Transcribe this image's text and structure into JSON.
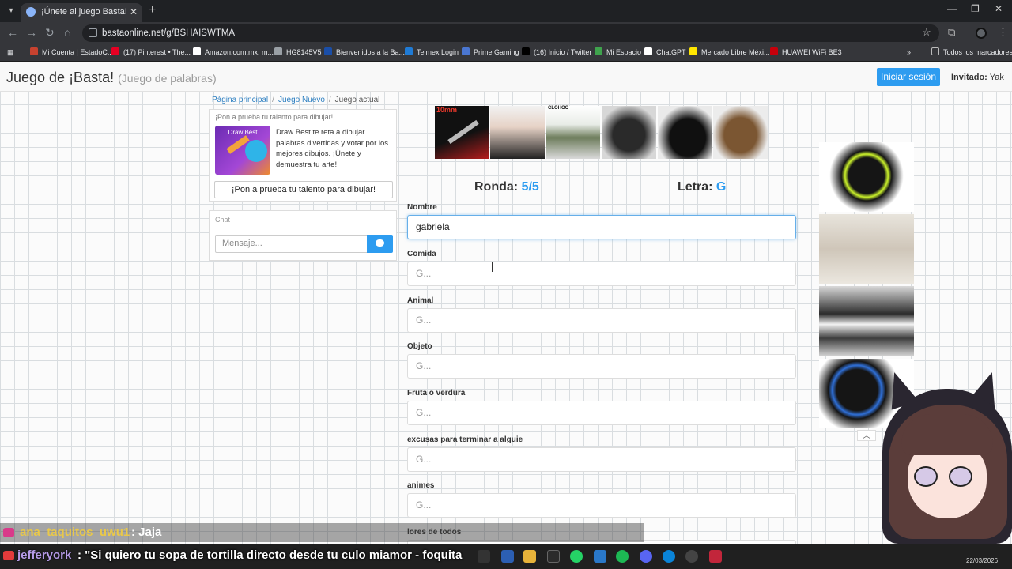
{
  "browser": {
    "tab_title": "¡Únete al juego Basta!",
    "tab_close": "✕",
    "new_tab": "+",
    "url": "bastaonline.net/g/BSHAISWTMA",
    "window_controls": [
      "—",
      "❐",
      "✕"
    ],
    "bookmarks": [
      {
        "label": "Mi Cuenta | EstadoC...",
        "color": "#c7422f"
      },
      {
        "label": "(17) Pinterest • The...",
        "color": "#e60023"
      },
      {
        "label": "Amazon.com.mx: m...",
        "color": "#ffffff"
      },
      {
        "label": "HG8145V5",
        "color": "#9aa0a6"
      },
      {
        "label": "Bienvenidos a la Ba...",
        "color": "#1a4ea8"
      },
      {
        "label": "Telmex Login",
        "color": "#1f7bd6"
      },
      {
        "label": "Prime Gaming",
        "color": "#4a76d1"
      },
      {
        "label": "(16) Inicio / Twitter",
        "color": "#000000"
      },
      {
        "label": "Mi Espacio",
        "color": "#3fa34d"
      },
      {
        "label": "ChatGPT",
        "color": "#ffffff"
      },
      {
        "label": "Mercado Libre Méxi...",
        "color": "#ffe600"
      },
      {
        "label": "HUAWEI WiFi BE3",
        "color": "#c7000b"
      }
    ],
    "bookmarks_more": "»",
    "all_bookmarks": "Todos los marcadores"
  },
  "header": {
    "title": "Juego de ¡Basta!",
    "subtitle": "(Juego de palabras)",
    "login_label": "Iniciar sesión",
    "guest_prefix": "Invitado:",
    "guest_name": "Yak"
  },
  "breadcrumb": {
    "home": "Página principal",
    "new_game": "Juego Nuevo",
    "current": "Juego actual",
    "sep": "/"
  },
  "promo": {
    "title": "¡Pon a prueba tu talento para dibujar!",
    "image_label": "Draw Best",
    "text": "Draw Best te reta a dibujar palabras divertidas y votar por los mejores dibujos. ¡Únete y demuestra tu arte!",
    "button_label": "¡Pon a prueba tu talento para dibujar!"
  },
  "chat": {
    "title": "Chat",
    "placeholder": "Mensaje..."
  },
  "ads": {
    "first_caption": "10mm",
    "third_caption": "CLOHOO"
  },
  "game": {
    "round_label": "Ronda:",
    "round_value": "5/5",
    "letter_label": "Letra:",
    "letter_value": "G",
    "fields": [
      {
        "label": "Nombre",
        "value": "gabriela",
        "placeholder": ""
      },
      {
        "label": "Comida",
        "value": "",
        "placeholder": "G..."
      },
      {
        "label": "Animal",
        "value": "",
        "placeholder": "G..."
      },
      {
        "label": "Objeto",
        "value": "",
        "placeholder": "G..."
      },
      {
        "label": "Fruta o verdura",
        "value": "",
        "placeholder": "G..."
      },
      {
        "label": "excusas para terminar a alguie",
        "value": "",
        "placeholder": "G..."
      },
      {
        "label": "animes",
        "value": "",
        "placeholder": "G..."
      },
      {
        "label": "lores de todos",
        "value": "",
        "placeholder": ""
      }
    ]
  },
  "sidebar_ads": {
    "scroll_up": "︿"
  },
  "stream_chat": [
    {
      "user": "ana_taquitos_uwu1",
      "message": ": Jaja"
    },
    {
      "user": "jefferyork",
      "message": ": \"Si quiero tu sopa de tortilla directo desde tu culo miamor - foquita"
    }
  ],
  "taskbar": {
    "date": "22/03/2026"
  }
}
